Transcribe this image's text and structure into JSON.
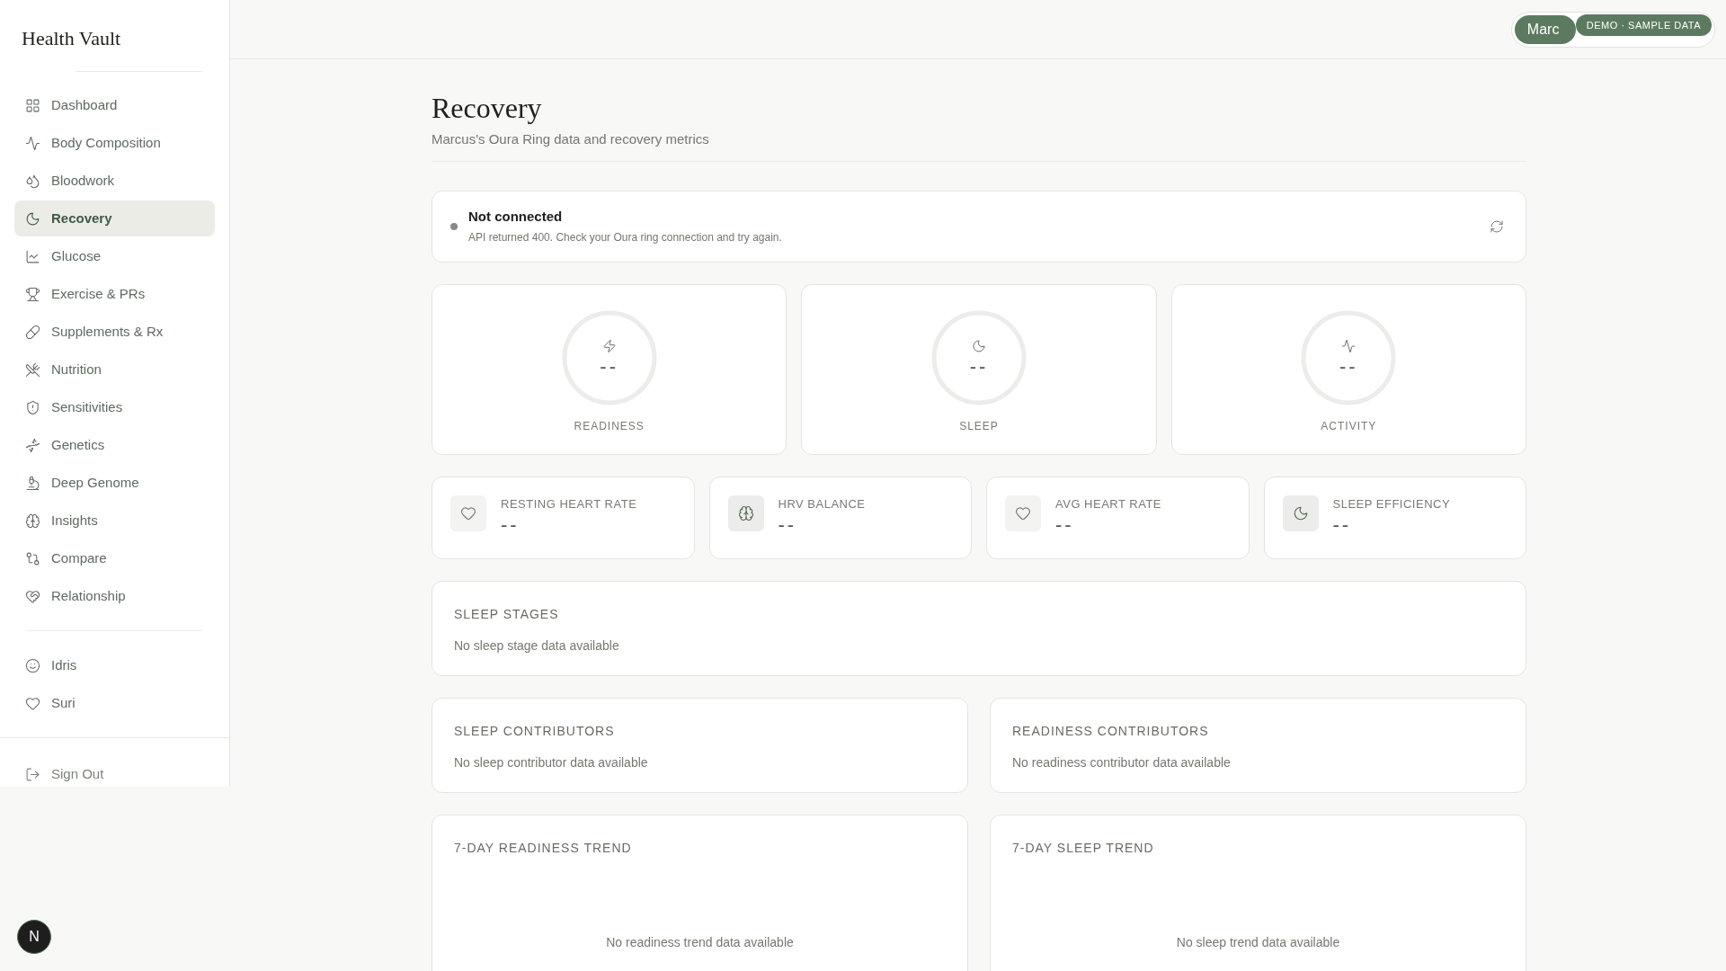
{
  "sidebar": {
    "logo": "Health Vault",
    "items": [
      {
        "label": "Dashboard",
        "selected": false
      },
      {
        "label": "Body Composition",
        "selected": false
      },
      {
        "label": "Bloodwork",
        "selected": false
      },
      {
        "label": "Recovery",
        "selected": true
      },
      {
        "label": "Glucose",
        "selected": false
      },
      {
        "label": "Exercise & PRs",
        "selected": false
      },
      {
        "label": "Supplements & Rx",
        "selected": false
      },
      {
        "label": "Nutrition",
        "selected": false
      },
      {
        "label": "Sensitivities",
        "selected": false
      },
      {
        "label": "Genetics",
        "selected": false
      },
      {
        "label": "Deep Genome",
        "selected": false
      },
      {
        "label": "Insights",
        "selected": false
      },
      {
        "label": "Compare",
        "selected": false
      },
      {
        "label": "Relationship",
        "selected": false
      }
    ],
    "people": [
      {
        "label": "Idris",
        "selected": false
      },
      {
        "label": "Suri",
        "selected": false
      }
    ],
    "sign_out": "Sign Out"
  },
  "header": {
    "user": "Marc",
    "badge": "DEMO · SAMPLE DATA"
  },
  "page": {
    "title": "Recovery",
    "subtitle": "Marcus's Oura Ring data and recovery metrics"
  },
  "status": {
    "title": "Not connected",
    "message": "API returned 400. Check your Oura ring connection and try again.",
    "color": "#8a8a85"
  },
  "scores": [
    {
      "label": "READINESS",
      "value": "--"
    },
    {
      "label": "SLEEP",
      "value": "--"
    },
    {
      "label": "ACTIVITY",
      "value": "--"
    }
  ],
  "metrics": [
    {
      "label": "RESTING HEART RATE",
      "value": "--"
    },
    {
      "label": "HRV BALANCE",
      "value": "--"
    },
    {
      "label": "AVG HEART RATE",
      "value": "--"
    },
    {
      "label": "SLEEP EFFICIENCY",
      "value": "--"
    }
  ],
  "sleep_stages": {
    "title": "SLEEP STAGES",
    "empty": "No sleep stage data available"
  },
  "contributors": [
    {
      "title": "SLEEP CONTRIBUTORS",
      "empty": "No sleep contributor data available"
    },
    {
      "title": "READINESS CONTRIBUTORS",
      "empty": "No readiness contributor data available"
    }
  ],
  "trends": [
    {
      "title": "7-DAY READINESS TREND",
      "empty": "No readiness trend data available"
    },
    {
      "title": "7-DAY SLEEP TREND",
      "empty": "No sleep trend data available"
    }
  ],
  "dev_badge": "N"
}
